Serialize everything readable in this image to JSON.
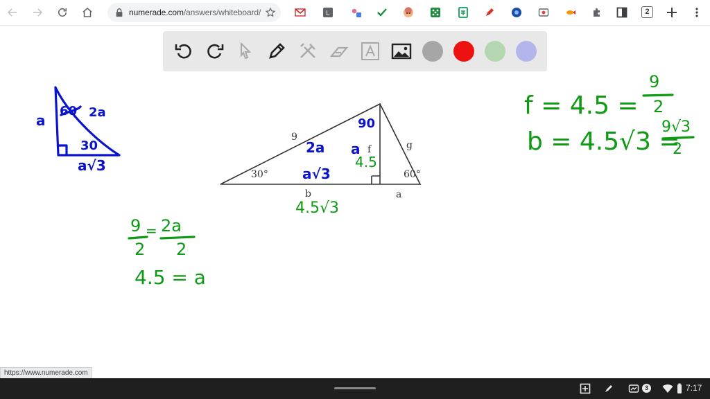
{
  "browser": {
    "url_host": "numerade.com",
    "url_path": "/answers/whiteboard/",
    "tab_count": "2",
    "status_link": "https://www.numerade.com"
  },
  "toolbar": {
    "tools": [
      "undo-icon",
      "redo-icon",
      "pointer-icon",
      "pen-icon",
      "tools-icon",
      "eraser-icon",
      "text-icon",
      "image-icon"
    ],
    "colors": [
      "#a6a6a6",
      "#ee1111",
      "#b4d6b0",
      "#b3b6ea"
    ]
  },
  "whiteboard": {
    "left_triangle": {
      "side_a": "a",
      "angle_60": "60",
      "hyp": "2a",
      "angle_30": "30",
      "base": "a√3"
    },
    "figure": {
      "hyp_label": "9",
      "angle_30": "30°",
      "angle_60": "60°",
      "f_label": "f",
      "g_label": "g",
      "b_label": "b",
      "a_label": "a"
    },
    "figure_annotations": {
      "top_angle": "90",
      "hyp": "2a",
      "alt": "a",
      "alt_value": "4.5",
      "base": "a√3",
      "base_value": "4.5√3"
    },
    "right_work": {
      "line1_lhs": "f = 4.5 =",
      "line1_num": "9",
      "line1_den": "2",
      "line2_lhs": "b = 4.5√3 =",
      "line2_num": "9√3",
      "line2_den": "2"
    },
    "left_work": {
      "num1": "9",
      "den1": "2",
      "eq": "=",
      "num2": "2a",
      "den2": "2",
      "line2": "4.5 = a"
    }
  },
  "shelf": {
    "notification_count": "3",
    "time": "7:17"
  }
}
